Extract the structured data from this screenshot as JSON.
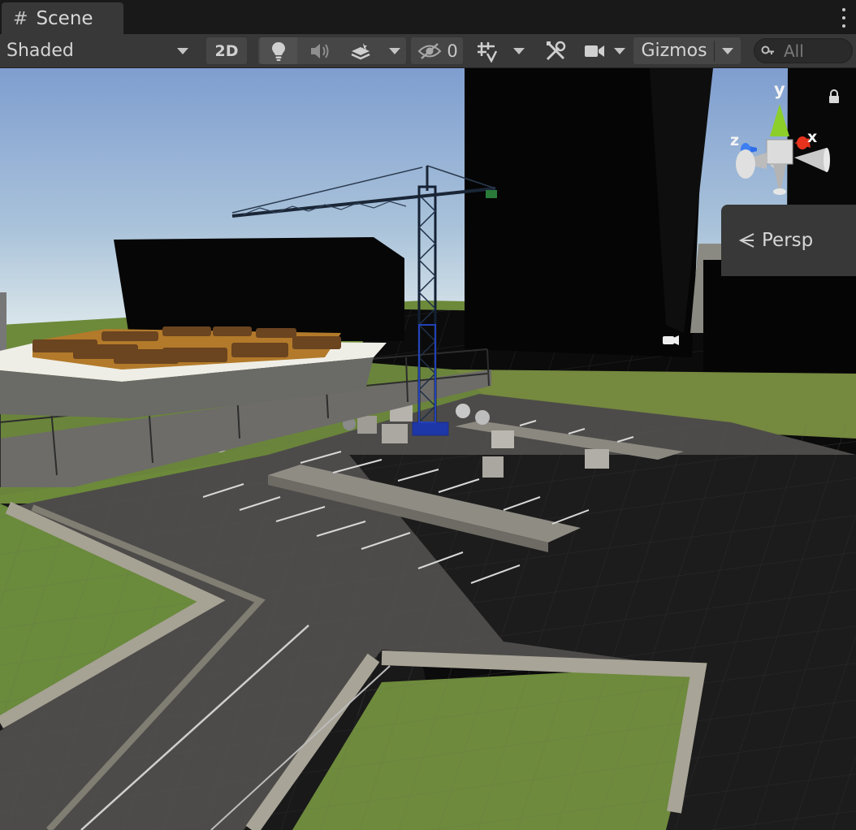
{
  "tab": {
    "title": "Scene",
    "icon": "grid-hash-icon"
  },
  "toolbar": {
    "draw_mode": "Shaded",
    "mode_2d": "2D",
    "hidden_count": "0",
    "gizmos": "Gizmos",
    "search_placeholder": "All"
  },
  "gizmo": {
    "x": "x",
    "y": "y",
    "z": "z",
    "projection": "Persp"
  },
  "colors": {
    "panel": "#383838",
    "background": "#191919",
    "sky_top": "#8aa8cf",
    "grass": "#6f8a3c",
    "asphalt": "#4a4846",
    "axis_x": "#e0311e",
    "axis_y": "#8cd62a",
    "axis_z": "#2e6dea"
  }
}
